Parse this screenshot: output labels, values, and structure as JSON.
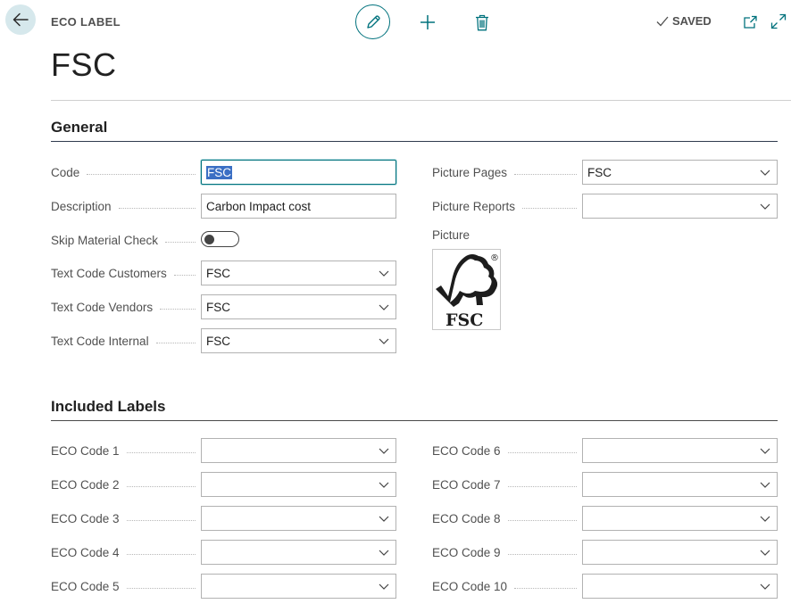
{
  "header": {
    "caption": "ECO LABEL",
    "title": "FSC",
    "saved_label": "SAVED"
  },
  "general": {
    "heading": "General",
    "left_fields": [
      {
        "label": "Code",
        "value": "FSC",
        "type": "text",
        "focused": true,
        "selected": true
      },
      {
        "label": "Description",
        "value": "Carbon Impact cost",
        "type": "text"
      },
      {
        "label": "Skip Material Check",
        "value": "off",
        "type": "toggle"
      },
      {
        "label": "Text Code Customers",
        "value": "FSC",
        "type": "select"
      },
      {
        "label": "Text Code Vendors",
        "value": "FSC",
        "type": "select"
      },
      {
        "label": "Text Code Internal",
        "value": "FSC",
        "type": "select"
      }
    ],
    "right_fields": [
      {
        "label": "Picture Pages",
        "value": "FSC",
        "type": "select"
      },
      {
        "label": "Picture Reports",
        "value": "",
        "type": "select"
      }
    ],
    "picture_label": "Picture",
    "picture_logo_text": "FSC",
    "picture_registered_mark": "®"
  },
  "included": {
    "heading": "Included Labels",
    "left_fields": [
      {
        "label": "ECO Code 1",
        "value": ""
      },
      {
        "label": "ECO Code 2",
        "value": ""
      },
      {
        "label": "ECO Code 3",
        "value": ""
      },
      {
        "label": "ECO Code 4",
        "value": ""
      },
      {
        "label": "ECO Code 5",
        "value": ""
      }
    ],
    "right_fields": [
      {
        "label": "ECO Code 6",
        "value": ""
      },
      {
        "label": "ECO Code 7",
        "value": ""
      },
      {
        "label": "ECO Code 8",
        "value": ""
      },
      {
        "label": "ECO Code 9",
        "value": ""
      },
      {
        "label": "ECO Code 10",
        "value": ""
      }
    ]
  },
  "colors": {
    "accent": "#00727d",
    "selection": "#3b6fc4",
    "back_button_bg": "#d6e8ec"
  },
  "icons": {
    "back": "arrow-left-icon",
    "edit": "pencil-icon",
    "new": "plus-icon",
    "delete": "trash-icon",
    "saved": "checkmark-icon",
    "open_new": "open-in-new-window-icon",
    "expand": "expand-icon"
  }
}
